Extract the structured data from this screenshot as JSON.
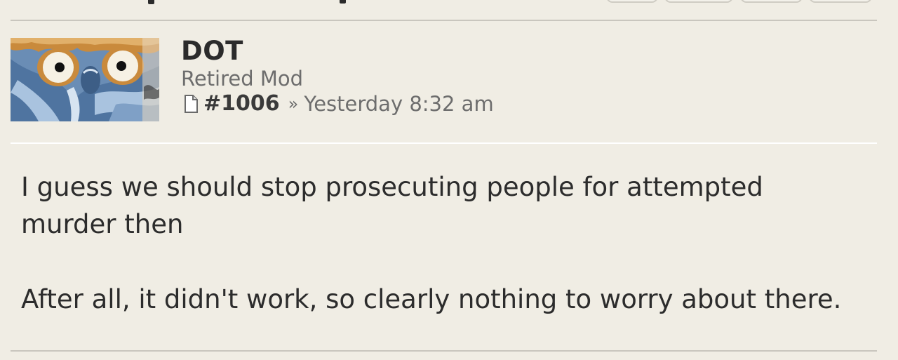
{
  "post": {
    "username": "DOT",
    "rank": "Retired Mod",
    "post_number": "#1006",
    "separator": "»",
    "timestamp": "Yesterday 8:32 am",
    "body": [
      "I guess we should stop prosecuting people for attempted murder then",
      "After all, it didn't work, so clearly nothing to worry about there."
    ]
  },
  "icons": {
    "post_link": "document-icon",
    "avatar": "cartoon-avatar"
  }
}
